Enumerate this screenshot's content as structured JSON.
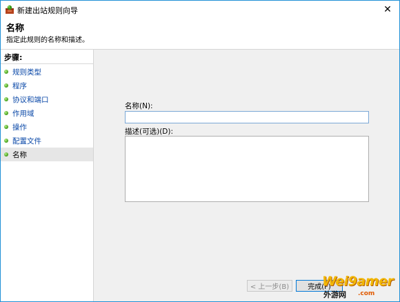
{
  "window": {
    "title": "新建出站规则向导",
    "close_glyph": "✕"
  },
  "header": {
    "title": "名称",
    "subtitle": "指定此规则的名称和描述。"
  },
  "steps": {
    "heading": "步骤:",
    "items": [
      {
        "label": "规则类型"
      },
      {
        "label": "程序"
      },
      {
        "label": "协议和端口"
      },
      {
        "label": "作用域"
      },
      {
        "label": "操作"
      },
      {
        "label": "配置文件"
      },
      {
        "label": "名称",
        "active": true
      }
    ]
  },
  "form": {
    "name_label": "名称(N):",
    "name_value": "",
    "description_label": "描述(可选)(D):",
    "description_value": ""
  },
  "buttons": {
    "back": "< 上一步(B)",
    "finish": "完成(F)"
  },
  "watermark": {
    "main": "Wei9amer",
    "sub": "外游网",
    "domain": ".com"
  },
  "colors": {
    "accent": "#0078d7",
    "step_link": "#0b49a8",
    "step_dot": "#3f9a16"
  }
}
